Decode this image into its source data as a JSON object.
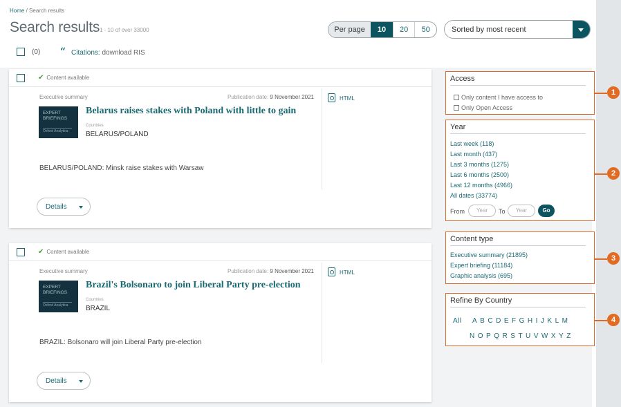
{
  "breadcrumb": {
    "home": "Home",
    "sep": "/",
    "current": "Search results"
  },
  "page": {
    "title": "Search results",
    "count_text": "1 - 10 of over 33000"
  },
  "toolbar": {
    "per_page_label": "Per page",
    "per_page_options": [
      "10",
      "20",
      "50"
    ],
    "per_page_selected": "10",
    "sort_value": "Sorted by most recent"
  },
  "selection": {
    "count": "(0)",
    "citations_label": "Citations:",
    "citations_action": "download RIS"
  },
  "results": [
    {
      "availability": "Content available",
      "type": "Executive summary",
      "pub_label": "Publication date:",
      "pub_date": "9 November 2021",
      "format": "HTML",
      "thumb_line1": "EXPERT",
      "thumb_line2": "BRIEFINGS",
      "thumb_logo": "Oxford Analytica",
      "title": "Belarus raises stakes with Poland with little to gain",
      "countries_label": "Countries",
      "countries": "BELARUS/POLAND",
      "summary": "BELARUS/POLAND: Minsk raise stakes with Warsaw",
      "details_label": "Details"
    },
    {
      "availability": "Content available",
      "type": "Executive summary",
      "pub_label": "Publication date:",
      "pub_date": "9 November 2021",
      "format": "HTML",
      "thumb_line1": "EXPERT",
      "thumb_line2": "BRIEFINGS",
      "thumb_logo": "Oxford Analytica",
      "title": "Brazil's Bolsonaro to join Liberal Party pre-election",
      "countries_label": "Countries",
      "countries": "BRAZIL",
      "summary": "BRAZIL: Bolsonaro will join Liberal Party pre-election",
      "details_label": "Details"
    }
  ],
  "facets": {
    "access": {
      "title": "Access",
      "options": [
        "Only content I have access to",
        "Only Open Access"
      ]
    },
    "year": {
      "title": "Year",
      "links": [
        "Last week (118)",
        "Last month (437)",
        "Last 3 months (1275)",
        "Last 6 months (2500)",
        "Last 12 months (4966)",
        "All dates (33774)"
      ],
      "from_label": "From",
      "to_label": "To",
      "from_placeholder": "Year",
      "to_placeholder": "Year",
      "go_label": "Go"
    },
    "content_type": {
      "title": "Content type",
      "links": [
        "Executive summary (21895)",
        "Expert briefing (11184)",
        "Graphic analysis (695)"
      ]
    },
    "country": {
      "title": "Refine By Country",
      "all_label": "All",
      "row1": [
        "A",
        "B",
        "C",
        "D",
        "E",
        "F",
        "G",
        "H",
        "I",
        "J",
        "K",
        "L",
        "M"
      ],
      "row2": [
        "N",
        "O",
        "P",
        "Q",
        "R",
        "S",
        "T",
        "U",
        "V",
        "W",
        "X",
        "Y",
        "Z"
      ]
    }
  },
  "callouts": [
    "1",
    "2",
    "3",
    "4"
  ],
  "colors": {
    "accent": "#1b6a73",
    "accent_dark": "#0c5560",
    "callout": "#e16b22",
    "check": "#4a9a3c"
  }
}
